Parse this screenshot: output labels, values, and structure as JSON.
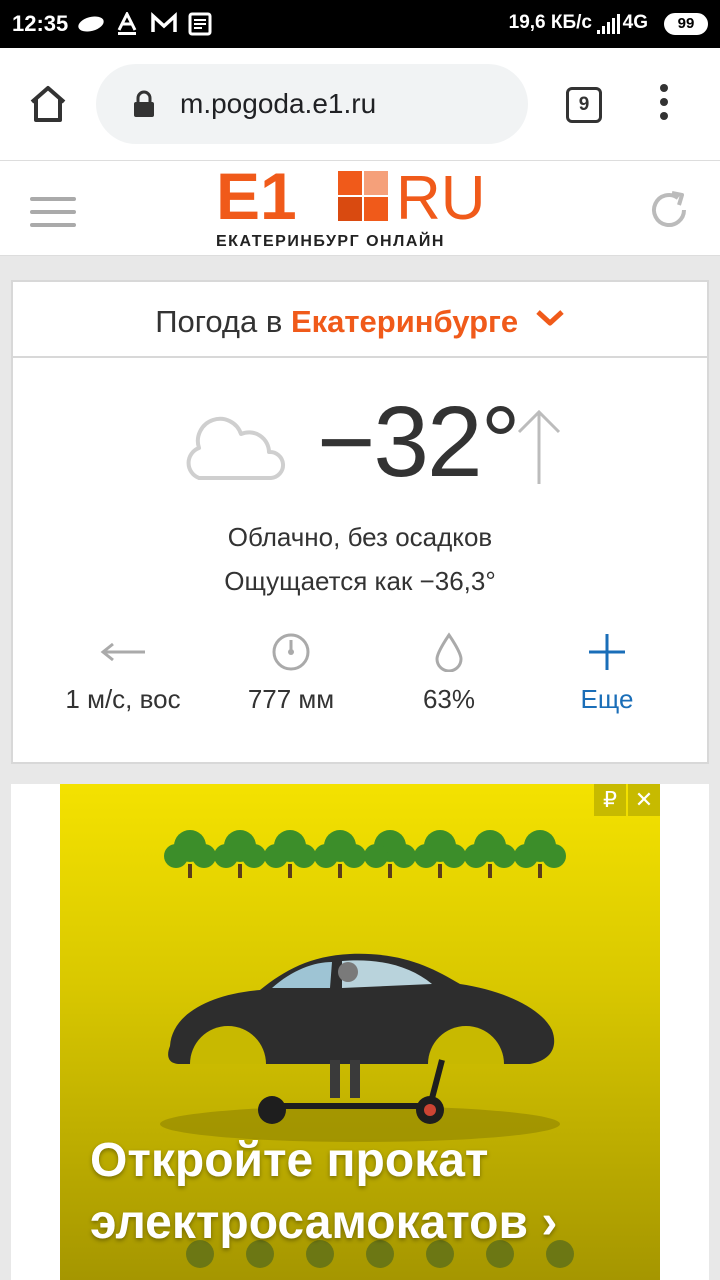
{
  "status_bar": {
    "time": "12:35",
    "net_speed": "19,6 КБ/с",
    "net_type": "4G",
    "battery": "99"
  },
  "browser": {
    "url": "m.pogoda.e1.ru",
    "tab_count": "9"
  },
  "site": {
    "logo_text": "E1",
    "logo_suffix": "RU",
    "tagline": "ЕКАТЕРИНБУРГ ОНЛАЙН",
    "brand_color": "#f05a1a"
  },
  "weather": {
    "title_prefix": "Погода в",
    "city": "Екатеринбурге",
    "temperature": "−32°",
    "condition": "Облачно, без осадков",
    "feels_like": "Ощущается как −36,3°",
    "wind": "1 м/с, вос",
    "pressure": "777 мм",
    "humidity": "63%",
    "more": "Еще",
    "more_color": "#1a6eb8"
  },
  "ad": {
    "currency_badge": "₽",
    "close_badge": "✕",
    "headline_line1": "Откройте прокат",
    "headline_line2": "электросамокатов ›"
  }
}
